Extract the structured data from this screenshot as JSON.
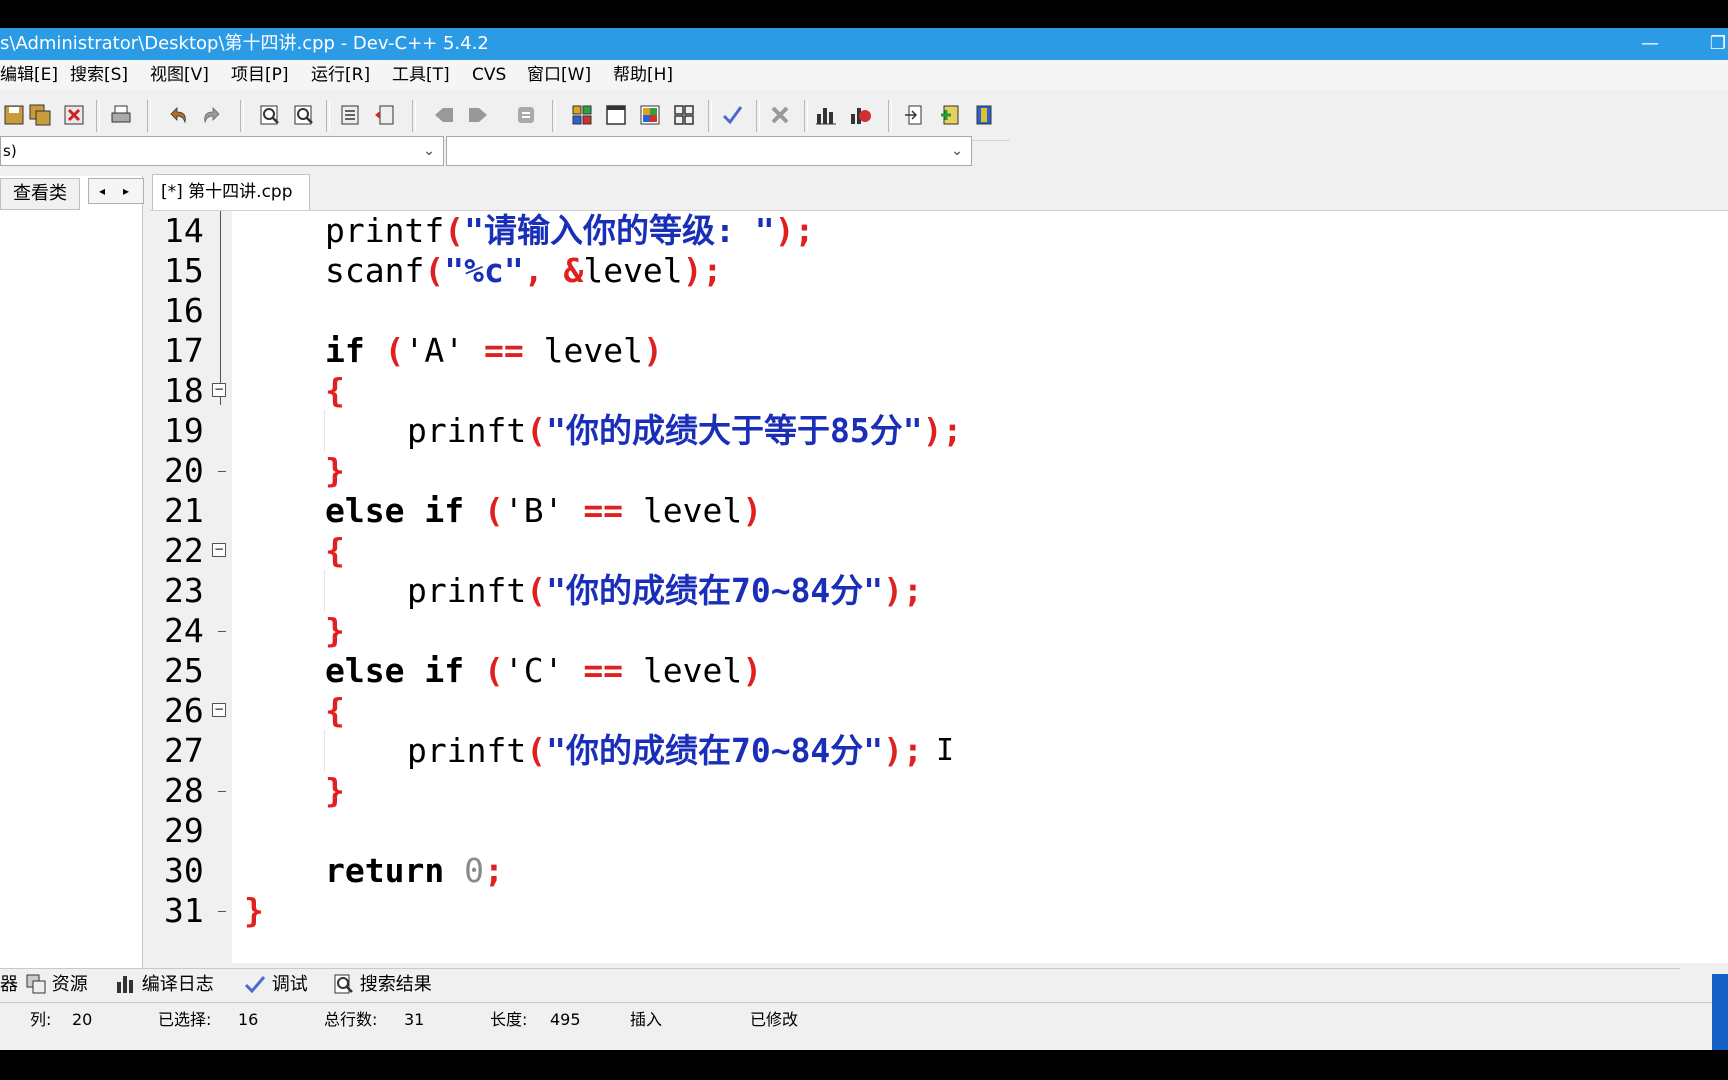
{
  "window": {
    "title": "s\\Administrator\\Desktop\\第十四讲.cpp - Dev-C++ 5.4.2",
    "minimize_label": "—",
    "restore_label": "❐"
  },
  "menu": [
    "编辑[E]",
    "搜索[S]",
    "视图[V]",
    "项目[P]",
    "运行[R]",
    "工具[T]",
    "CVS",
    "窗口[W]",
    "帮助[H]"
  ],
  "toolbar_icons": [
    "save-icon",
    "save-all-icon",
    "close-file-icon",
    "print-icon",
    "undo-icon",
    "redo-icon",
    "find-icon",
    "replace-icon",
    "indent-icon",
    "unindent-icon",
    "bookmark-prev-icon",
    "bookmark-next-icon",
    "toggle-comment-icon",
    "compile-icon",
    "run-icon",
    "compile-run-icon",
    "rebuild-icon",
    "syntax-check-icon",
    "stop-icon",
    "chart-icon",
    "debug-icon",
    "goto-icon",
    "add-icon",
    "exit-icon"
  ],
  "combos": {
    "left_value": "s)",
    "right_value": ""
  },
  "left_panel": {
    "tab_label": "查看类",
    "prev": "◂",
    "next": "▸"
  },
  "file_tab": "[*] 第十四讲.cpp",
  "code_lines": [
    {
      "num": "14",
      "fold": ""
    },
    {
      "num": "15",
      "fold": ""
    },
    {
      "num": "16",
      "fold": ""
    },
    {
      "num": "17",
      "fold": ""
    },
    {
      "num": "18",
      "fold": "start"
    },
    {
      "num": "19",
      "fold": ""
    },
    {
      "num": "20",
      "fold": "end"
    },
    {
      "num": "21",
      "fold": ""
    },
    {
      "num": "22",
      "fold": "start"
    },
    {
      "num": "23",
      "fold": ""
    },
    {
      "num": "24",
      "fold": "end"
    },
    {
      "num": "25",
      "fold": ""
    },
    {
      "num": "26",
      "fold": "start"
    },
    {
      "num": "27",
      "fold": ""
    },
    {
      "num": "28",
      "fold": "end"
    },
    {
      "num": "29",
      "fold": ""
    },
    {
      "num": "30",
      "fold": ""
    },
    {
      "num": "31",
      "fold": "end"
    }
  ],
  "code": {
    "l14": {
      "fn": "printf",
      "s": "\"请输入你的等级: \""
    },
    "l15": {
      "fn": "scanf",
      "s": "\"%c\"",
      "comma": ", ",
      "amp": "&",
      "arg": "level"
    },
    "l17": {
      "kw": "if",
      "lit": "'A'",
      "op": "==",
      "var": "level"
    },
    "l18": "{",
    "l19": {
      "fn": "prinft",
      "s": "\"你的成绩大于等于85分\""
    },
    "l20": "}",
    "l21": {
      "kw": "else if",
      "lit": "'B'",
      "op": "==",
      "var": "level"
    },
    "l22": "{",
    "l23": {
      "fn": "prinft",
      "s": "\"你的成绩在70~84分\""
    },
    "l24": "}",
    "l25": {
      "kw": "else if",
      "lit": "'C'",
      "op": "==",
      "var": "level"
    },
    "l26": "{",
    "l27": {
      "fn": "prinft",
      "s": "\"你的成绩在70~84分\""
    },
    "l28": "}",
    "l30": {
      "kw": "return",
      "num": "0",
      "semi": ";"
    },
    "l31": "}",
    "open": "(",
    "close": ")",
    "semi": ";",
    "cursor": "I"
  },
  "bottom_tabs": [
    "器",
    "资源",
    "编译日志",
    "调试",
    "搜索结果"
  ],
  "status": {
    "col_label": "列:",
    "col_value": "20",
    "sel_label": "已选择:",
    "sel_value": "16",
    "lines_label": "总行数:",
    "lines_value": "31",
    "len_label": "长度:",
    "len_value": "495",
    "mode": "插入",
    "modified": "已修改"
  },
  "colors": {
    "title_bar": "#2b9be6",
    "keyword": "#000000",
    "string": "#1a2fb8",
    "symbol": "#e02020",
    "number": "#8a8a8a"
  }
}
